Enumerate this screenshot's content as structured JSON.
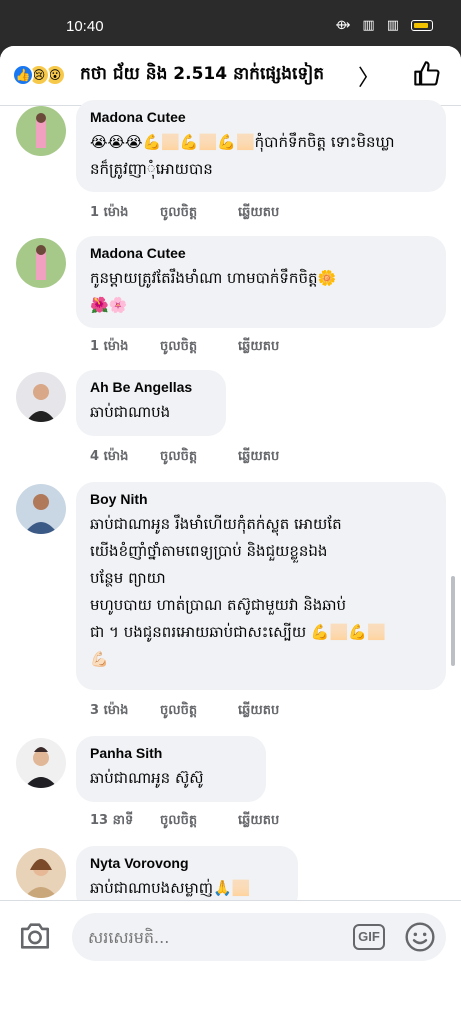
{
  "status_bar": {
    "time": "10:40"
  },
  "header": {
    "reactor_text": "កថា ជ័យ និង 2.514 នាក់ផ្សេងទៀត",
    "chevron": "〉"
  },
  "comments": [
    {
      "author": "Madona Cutee",
      "text_lines": [
        "😭😭😭💪🏻💪🏻💪🏻កុំបាក់ទឹកចិត្ត ទោះមិនឃ្លា",
        "នក៏ត្រូវញាុំអោយបាន"
      ],
      "time": "1 ម៉ោង",
      "like": "ចូលចិត្ត",
      "reply": "ឆ្លើយតប"
    },
    {
      "author": "Madona Cutee",
      "text_lines": [
        "កូនម្ដាយត្រូវតែរឹងមាំណា ហាមបាក់ទឹកចិត្ត🌼",
        "🌺🌸"
      ],
      "time": "1 ម៉ោង",
      "like": "ចូលចិត្ត",
      "reply": "ឆ្លើយតប"
    },
    {
      "author": "Ah Be Angellas",
      "text_lines": [
        "ឆាប់ជាណាបង"
      ],
      "time": "4 ម៉ោង",
      "like": "ចូលចិត្ត",
      "reply": "ឆ្លើយតប"
    },
    {
      "author": "Boy Nith",
      "text_lines": [
        "ឆាប់ជាណាអូន រឹងមាំហើយកុំតក់ស្លុត អោយតែ",
        "យើងខំញាំថ្នាំតាមពេទ្យប្រាប់ និងជួយខ្លួនឯង",
        "បន្ថែម ព្យាយា",
        "មហូបបាយ ហាត់ប្រាណ តស៊ូជាមួយវា និងឆាប់",
        "ជា ។ បងជូនពរអោយឆាប់ជាសះស្បើយ 💪🏻💪🏻",
        "💪🏻"
      ],
      "time": "3 ម៉ោង",
      "like": "ចូលចិត្ត",
      "reply": "ឆ្លើយតប"
    },
    {
      "author": "Panha Sith",
      "text_lines": [
        "ឆាប់ជាណាអូន ស៊ូស៊ូ"
      ],
      "time": "13 នាទី",
      "like": "ចូលចិត្ត",
      "reply": "ឆ្លើយតប"
    },
    {
      "author": "Nyta Vorovong",
      "text_lines": [
        "ឆាប់ជាណាបងសម្លាញ់🙏🏻"
      ],
      "time": "",
      "like": "",
      "reply": ""
    }
  ],
  "composer": {
    "placeholder": "សរសេរមតិ...",
    "gif_label": "GIF"
  },
  "colors": {
    "accent": "#1877f2",
    "bubble": "#f0f2f5",
    "meta": "#65676b"
  },
  "icons": [
    "camera-icon",
    "gif-icon",
    "smiley-icon",
    "thumbs-up-icon",
    "chevron-right-icon",
    "menu-icon",
    "home-icon",
    "back-icon"
  ]
}
